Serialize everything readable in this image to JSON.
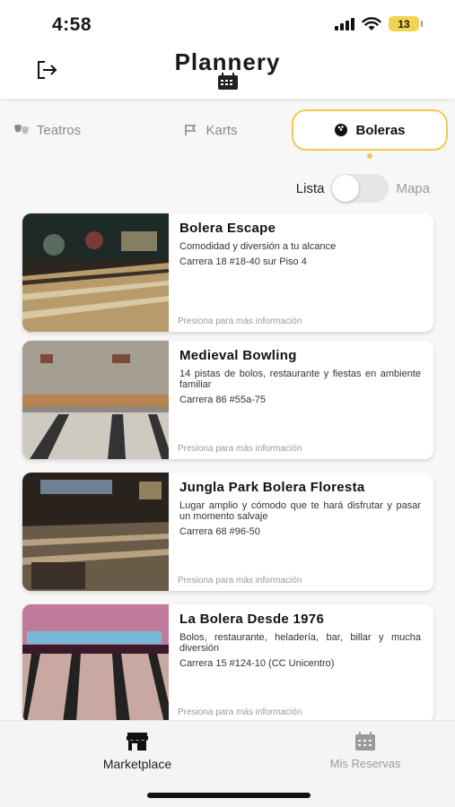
{
  "status_bar": {
    "time": "4:58",
    "battery": "13"
  },
  "header": {
    "title": "Plannery"
  },
  "tabs": [
    {
      "label": "Teatros",
      "icon": "theater-masks-icon",
      "active": false
    },
    {
      "label": "Karts",
      "icon": "go-kart-icon",
      "active": false
    },
    {
      "label": "Boleras",
      "icon": "bowling-ball-icon",
      "active": true
    }
  ],
  "view_toggle": {
    "list_label": "Lista",
    "map_label": "Mapa",
    "selected": "Lista"
  },
  "cards": [
    {
      "title": "Bolera Escape",
      "description": "Comodidad y diversión a tu alcance",
      "address": "Carrera 18 #18-40 sur Piso 4",
      "footer": "Presiona para más información"
    },
    {
      "title": "Medieval Bowling",
      "description": "14 pistas de bolos, restaurante y fiestas en ambiente familiar",
      "address": "Carrera 86 #55a-75",
      "footer": "Presiona para más información"
    },
    {
      "title": "Jungla Park Bolera Floresta",
      "description": "Lugar amplio y cómodo que te hará disfrutar y pasar un momento salvaje",
      "address": "Carrera 68 #96-50",
      "footer": "Presiona para más información"
    },
    {
      "title": "La Bolera Desde 1976",
      "description": "Bolos, restaurante, heladería, bar, billar y mucha diversión",
      "address": "Carrera 15 #124-10 (CC Unicentro)",
      "footer": "Presiona para más información"
    }
  ],
  "bottom_nav": [
    {
      "label": "Marketplace",
      "icon": "storefront-icon",
      "active": true
    },
    {
      "label": "Mis Reservas",
      "icon": "calendar-icon",
      "active": false
    }
  ],
  "colors": {
    "accent": "#f2c94c",
    "background": "#f7f7f7",
    "muted_text": "#9a9a9a"
  }
}
